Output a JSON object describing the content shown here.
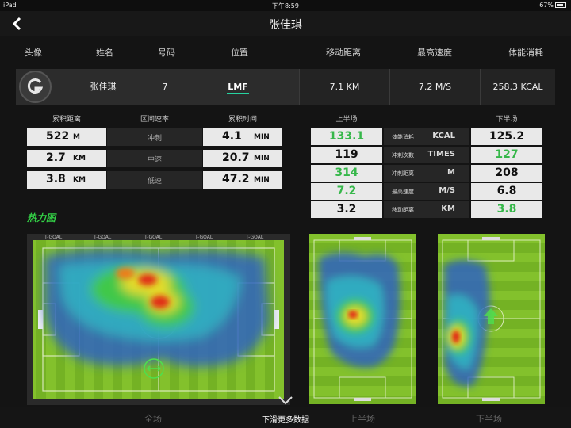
{
  "status": {
    "device": "iPad",
    "time": "下午8:59",
    "battery": "67%"
  },
  "nav": {
    "title": "张佳琪"
  },
  "columns": [
    "头像",
    "姓名",
    "号码",
    "位置",
    "移动距离",
    "最高速度",
    "体能消耗"
  ],
  "player": {
    "name": "张佳琪",
    "number": "7",
    "position": "LMF",
    "distance": "7.1 KM",
    "top_speed": "7.2 M/S",
    "energy": "258.3 KCAL"
  },
  "zones": {
    "headers": [
      "累积距离",
      "区间速率",
      "累积时间"
    ],
    "rows": [
      {
        "distance": "522",
        "distance_unit": "M",
        "zone": "冲刺",
        "time": "4.1",
        "time_unit": "MIN"
      },
      {
        "distance": "2.7",
        "distance_unit": "KM",
        "zone": "中速",
        "time": "20.7",
        "time_unit": "MIN"
      },
      {
        "distance": "3.8",
        "distance_unit": "KM",
        "zone": "低速",
        "time": "47.2",
        "time_unit": "MIN"
      }
    ]
  },
  "halves": {
    "headers": [
      "上半场",
      "下半场"
    ],
    "rows": [
      {
        "first": "133.1",
        "label": "体能消耗",
        "unit": "KCAL",
        "second": "125.2",
        "first_green": true,
        "second_green": false
      },
      {
        "first": "119",
        "label": "冲刺次数",
        "unit": "TIMES",
        "second": "127",
        "first_green": false,
        "second_green": true
      },
      {
        "first": "314",
        "label": "冲刺距离",
        "unit": "M",
        "second": "208",
        "first_green": true,
        "second_green": false
      },
      {
        "first": "7.2",
        "label": "最高速度",
        "unit": "M/S",
        "second": "6.8",
        "first_green": true,
        "second_green": false
      },
      {
        "first": "3.2",
        "label": "移动距离",
        "unit": "KM",
        "second": "3.8",
        "first_green": false,
        "second_green": true
      }
    ]
  },
  "heatmap": {
    "title": "热力图",
    "board_text": "T-GOAL"
  },
  "tabs": {
    "full": "全场",
    "first": "上半场",
    "second": "下半场"
  },
  "scroll_hint": "下滑更多数据",
  "colors": {
    "accent": "#33d046",
    "position_underline": "#26d3a0"
  }
}
